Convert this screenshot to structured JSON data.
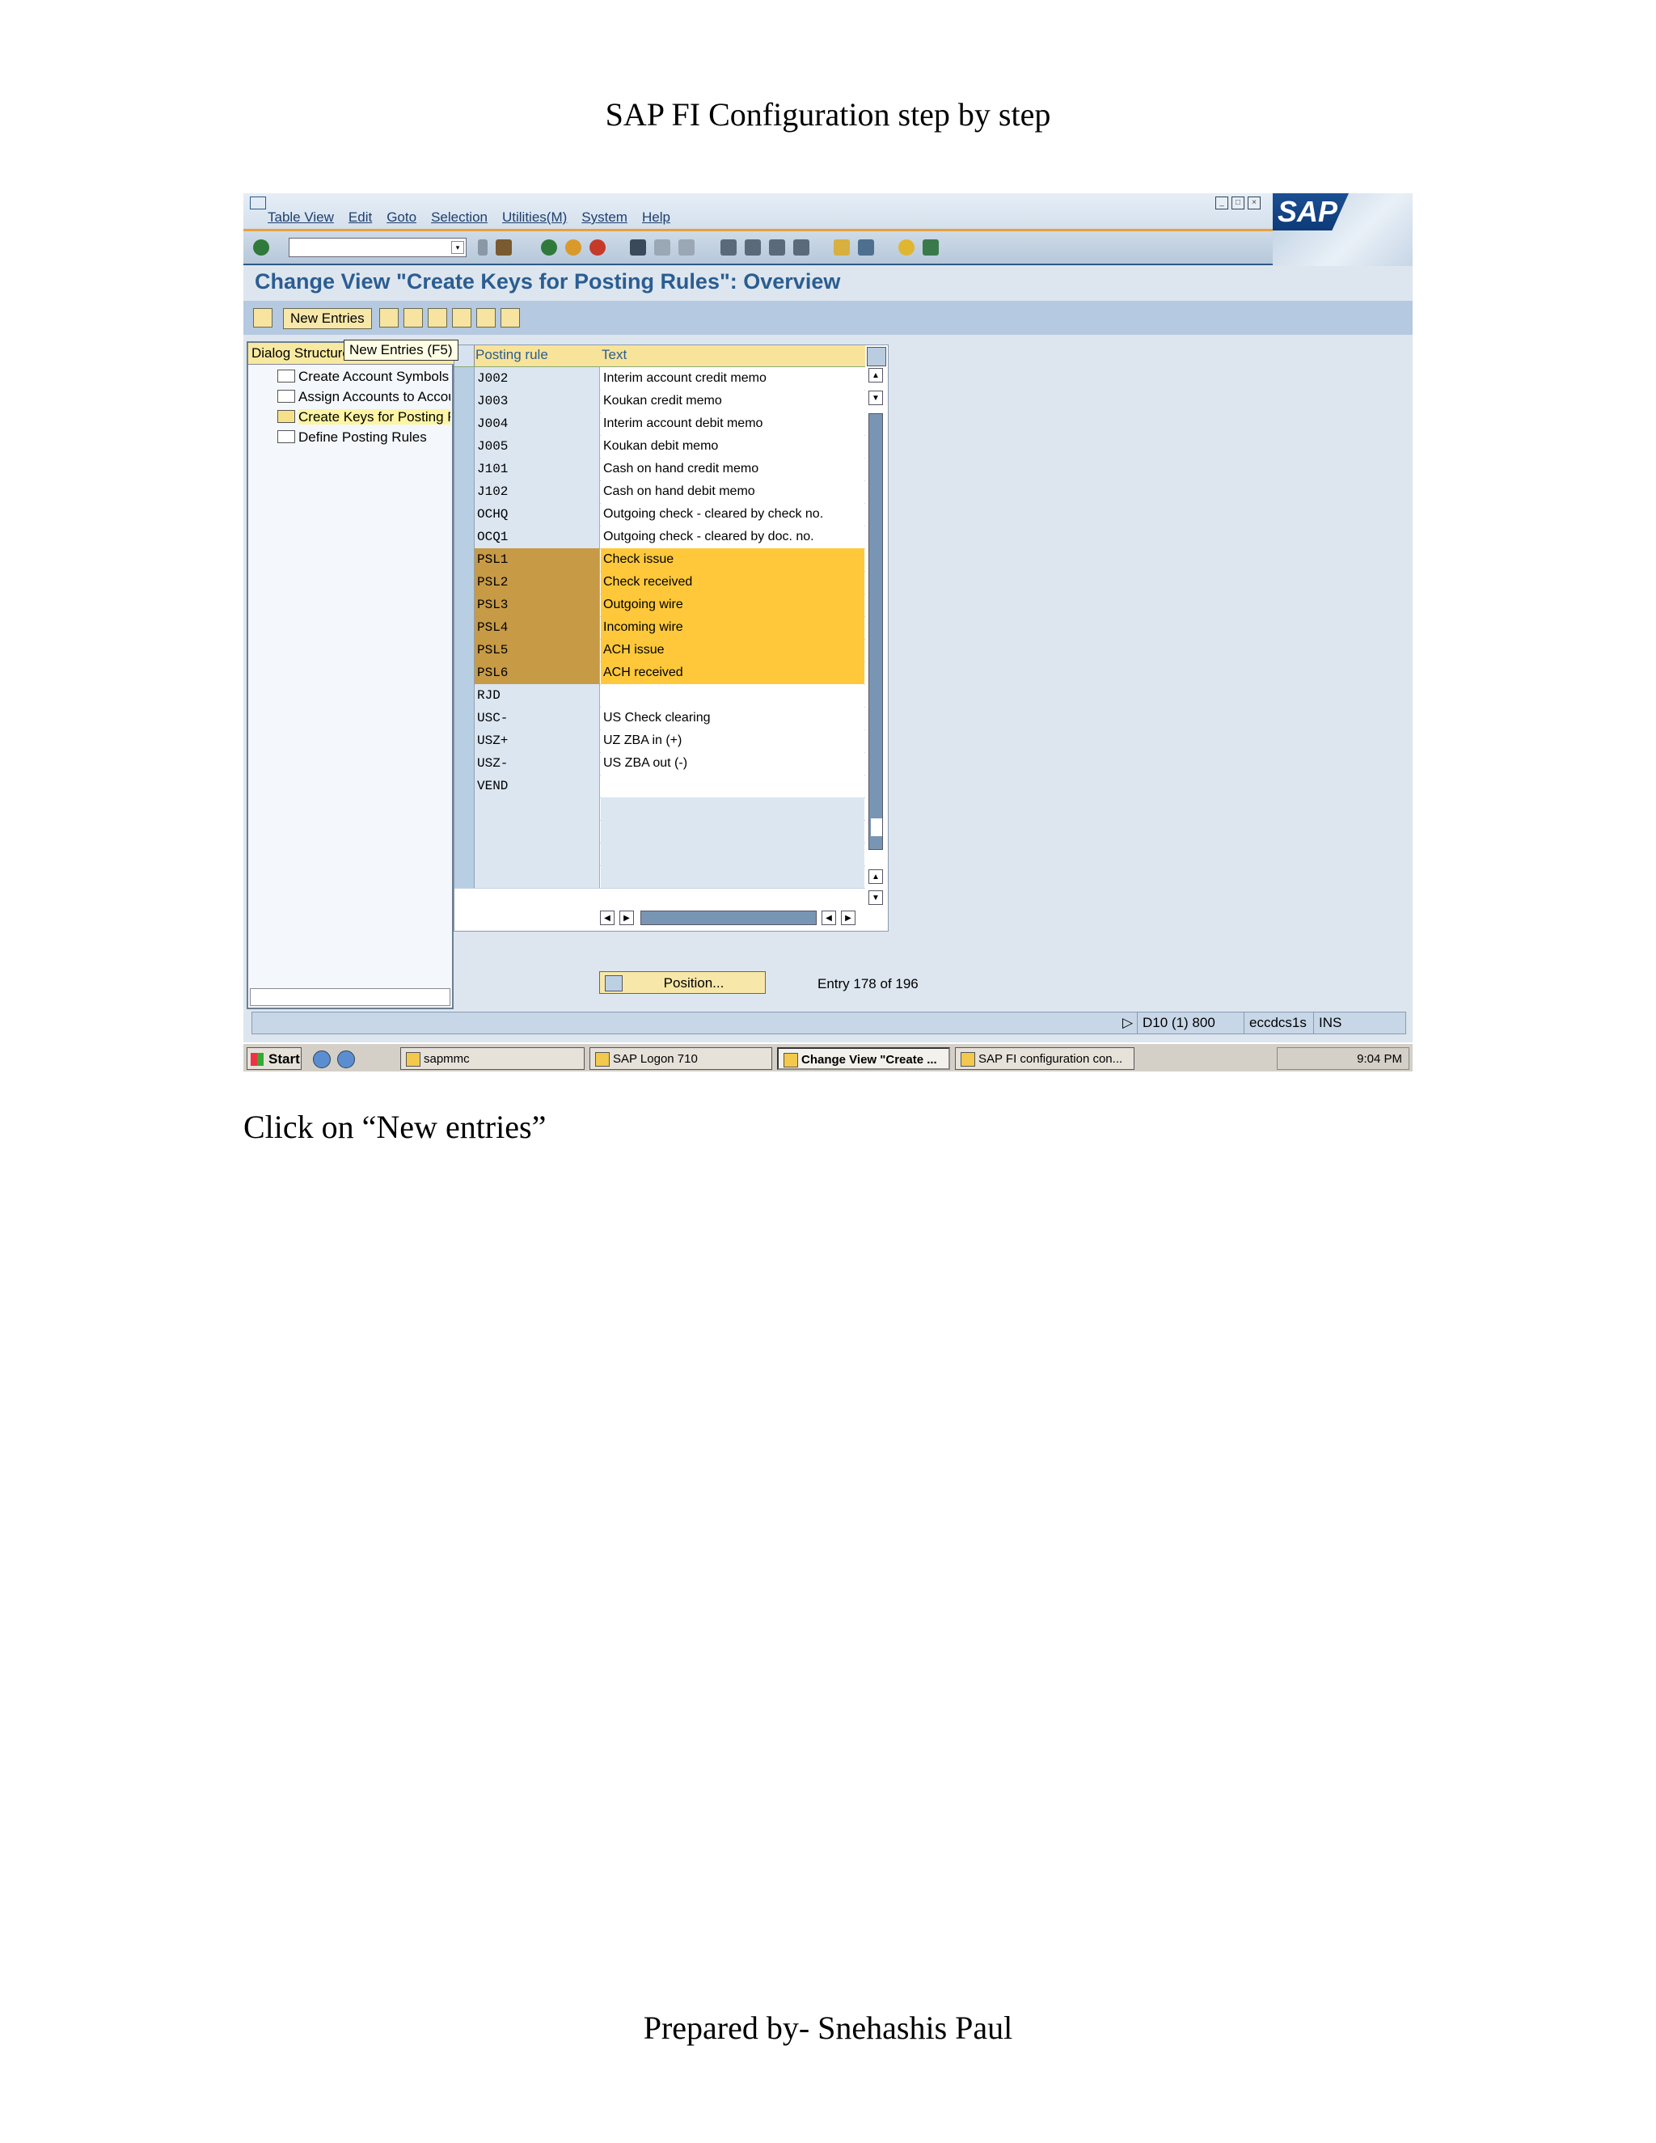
{
  "document": {
    "header": "SAP FI Configuration step by step",
    "caption": "Click on “New entries”",
    "footer": "Prepared by- Snehashis Paul"
  },
  "sap_window": {
    "menu": [
      "Table View",
      "Edit",
      "Goto",
      "Selection",
      "Utilities(M)",
      "System",
      "Help"
    ],
    "logo_text": "SAP",
    "title": "Change View \"Create Keys for Posting Rules\": Overview",
    "new_entries_label": "New Entries",
    "tooltip": "New Entries   (F5)",
    "dialog_structure": {
      "header": "Dialog Structure",
      "items": [
        {
          "label": "Create Account Symbols",
          "selected": false
        },
        {
          "label": "Assign Accounts to Account Symbols",
          "selected": false
        },
        {
          "label": "Create Keys for Posting Rules",
          "selected": true
        },
        {
          "label": "Define Posting Rules",
          "selected": false
        }
      ]
    },
    "table": {
      "columns": [
        "Posting rule",
        "Text"
      ],
      "rows": [
        {
          "rule": "J002",
          "text": "Interim account credit memo",
          "highlighted": false
        },
        {
          "rule": "J003",
          "text": "Koukan credit memo",
          "highlighted": false
        },
        {
          "rule": "J004",
          "text": "Interim account debit memo",
          "highlighted": false
        },
        {
          "rule": "J005",
          "text": "Koukan debit memo",
          "highlighted": false
        },
        {
          "rule": "J101",
          "text": "Cash on hand credit memo",
          "highlighted": false
        },
        {
          "rule": "J102",
          "text": "Cash on hand debit memo",
          "highlighted": false
        },
        {
          "rule": "OCHQ",
          "text": "Outgoing check - cleared by check no.",
          "highlighted": false
        },
        {
          "rule": "OCQ1",
          "text": "Outgoing check - cleared by doc. no.",
          "highlighted": false
        },
        {
          "rule": "PSL1",
          "text": "Check issue",
          "highlighted": true
        },
        {
          "rule": "PSL2",
          "text": "Check received",
          "highlighted": true
        },
        {
          "rule": "PSL3",
          "text": "Outgoing wire",
          "highlighted": true
        },
        {
          "rule": "PSL4",
          "text": "Incoming wire",
          "highlighted": true
        },
        {
          "rule": "PSL5",
          "text": "ACH issue",
          "highlighted": true
        },
        {
          "rule": "PSL6",
          "text": "ACH received",
          "highlighted": true
        },
        {
          "rule": "RJD",
          "text": "",
          "highlighted": false
        },
        {
          "rule": "USC-",
          "text": "US Check clearing",
          "highlighted": false
        },
        {
          "rule": "USZ+",
          "text": "UZ ZBA in (+)",
          "highlighted": false
        },
        {
          "rule": "USZ-",
          "text": "US ZBA out (-)",
          "highlighted": false
        },
        {
          "rule": "VEND",
          "text": "",
          "highlighted": false
        }
      ],
      "empty_rows": 4
    },
    "position_button": "Position...",
    "entry_info": "Entry 178 of 196",
    "status": {
      "system": "D10 (1) 800",
      "server": "eccdcs1s",
      "mode": "INS"
    },
    "taskbar": {
      "start": "Start",
      "tasks": [
        {
          "label": "sapmmc",
          "active": false
        },
        {
          "label": "SAP Logon 710",
          "active": false
        },
        {
          "label": "Change View \"Create ...",
          "active": true
        },
        {
          "label": "SAP FI configuration con...",
          "active": false
        }
      ],
      "clock": "9:04 PM"
    }
  },
  "colors": {
    "highlight_rule": "#c79a45",
    "highlight_text": "#fec83a",
    "title_blue": "#2b5d91"
  }
}
